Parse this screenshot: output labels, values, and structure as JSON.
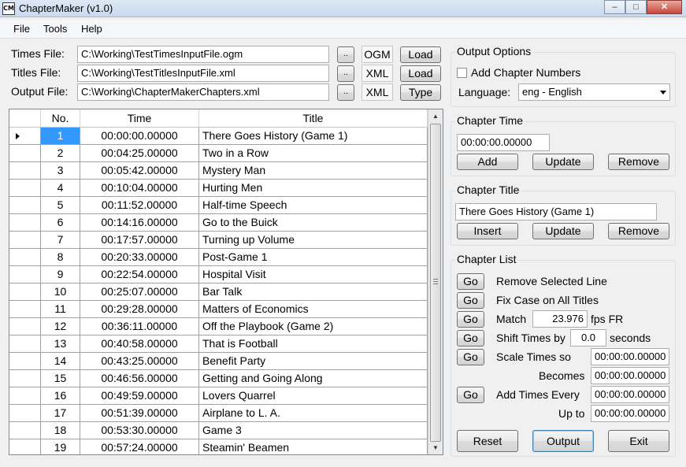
{
  "window": {
    "icon_text": "CM",
    "title": "ChapterMaker (v1.0)",
    "minimize": "–",
    "maximize": "□",
    "close": "✕"
  },
  "menu": [
    "File",
    "Tools",
    "Help"
  ],
  "files": {
    "times_label": "Times File:",
    "times_value": "C:\\Working\\TestTimesInputFile.ogm",
    "times_browse": "..",
    "times_ext": "OGM",
    "times_action": "Load",
    "titles_label": "Titles File:",
    "titles_value": "C:\\Working\\TestTitlesInputFile.xml",
    "titles_browse": "..",
    "titles_ext": "XML",
    "titles_action": "Load",
    "output_label": "Output File:",
    "output_value": "C:\\Working\\ChapterMakerChapters.xml",
    "output_browse": "..",
    "output_ext": "XML",
    "output_action": "Type"
  },
  "grid": {
    "headers": [
      "No.",
      "Time",
      "Title"
    ],
    "scroll_up": "▲",
    "scroll_down": "▼",
    "rows": [
      {
        "no": "1",
        "time": "00:00:00.00000",
        "title": "There Goes History (Game 1)"
      },
      {
        "no": "2",
        "time": "00:04:25.00000",
        "title": "Two in a Row"
      },
      {
        "no": "3",
        "time": "00:05:42.00000",
        "title": "Mystery Man"
      },
      {
        "no": "4",
        "time": "00:10:04.00000",
        "title": "Hurting Men"
      },
      {
        "no": "5",
        "time": "00:11:52.00000",
        "title": "Half-time Speech"
      },
      {
        "no": "6",
        "time": "00:14:16.00000",
        "title": "Go to the Buick"
      },
      {
        "no": "7",
        "time": "00:17:57.00000",
        "title": "Turning up Volume"
      },
      {
        "no": "8",
        "time": "00:20:33.00000",
        "title": "Post-Game 1"
      },
      {
        "no": "9",
        "time": "00:22:54.00000",
        "title": "Hospital Visit"
      },
      {
        "no": "10",
        "time": "00:25:07.00000",
        "title": "Bar Talk"
      },
      {
        "no": "11",
        "time": "00:29:28.00000",
        "title": "Matters of Economics"
      },
      {
        "no": "12",
        "time": "00:36:11.00000",
        "title": "Off the Playbook (Game 2)"
      },
      {
        "no": "13",
        "time": "00:40:58.00000",
        "title": "That is Football"
      },
      {
        "no": "14",
        "time": "00:43:25.00000",
        "title": "Benefit Party"
      },
      {
        "no": "15",
        "time": "00:46:56.00000",
        "title": "Getting and Going Along"
      },
      {
        "no": "16",
        "time": "00:49:59.00000",
        "title": "Lovers Quarrel"
      },
      {
        "no": "17",
        "time": "00:51:39.00000",
        "title": "Airplane to L. A."
      },
      {
        "no": "18",
        "time": "00:53:30.00000",
        "title": "Game 3"
      },
      {
        "no": "19",
        "time": "00:57:24.00000",
        "title": "Steamin' Beamen"
      }
    ]
  },
  "output_options": {
    "title": "Output Options",
    "add_numbers_label": "Add Chapter Numbers",
    "add_numbers_checked": false,
    "language_label": "Language:",
    "language_value": "eng - English"
  },
  "chapter_time": {
    "title": "Chapter Time",
    "value": "00:00:00.00000",
    "add": "Add",
    "update": "Update",
    "remove": "Remove"
  },
  "chapter_title": {
    "title": "Chapter Title",
    "value": "There Goes History (Game 1)",
    "insert": "Insert",
    "update": "Update",
    "remove": "Remove"
  },
  "chapter_list": {
    "title": "Chapter List",
    "go": "Go",
    "remove_selected": "Remove Selected Line",
    "fix_case": "Fix Case on All Titles",
    "match_label": "Match",
    "match_value": "23.976",
    "match_unit": "fps FR",
    "shift_label": "Shift Times by",
    "shift_value": "0.0",
    "shift_unit": "seconds",
    "scale_label": "Scale Times so",
    "scale_from": "00:00:00.00000",
    "becomes_label": "Becomes",
    "scale_to": "00:00:00.00000",
    "add_every_label": "Add Times Every",
    "add_every_value": "00:00:00.00000",
    "up_to_label": "Up to",
    "up_to_value": "00:00:00.00000"
  },
  "actions": {
    "reset": "Reset",
    "output": "Output",
    "exit": "Exit"
  }
}
